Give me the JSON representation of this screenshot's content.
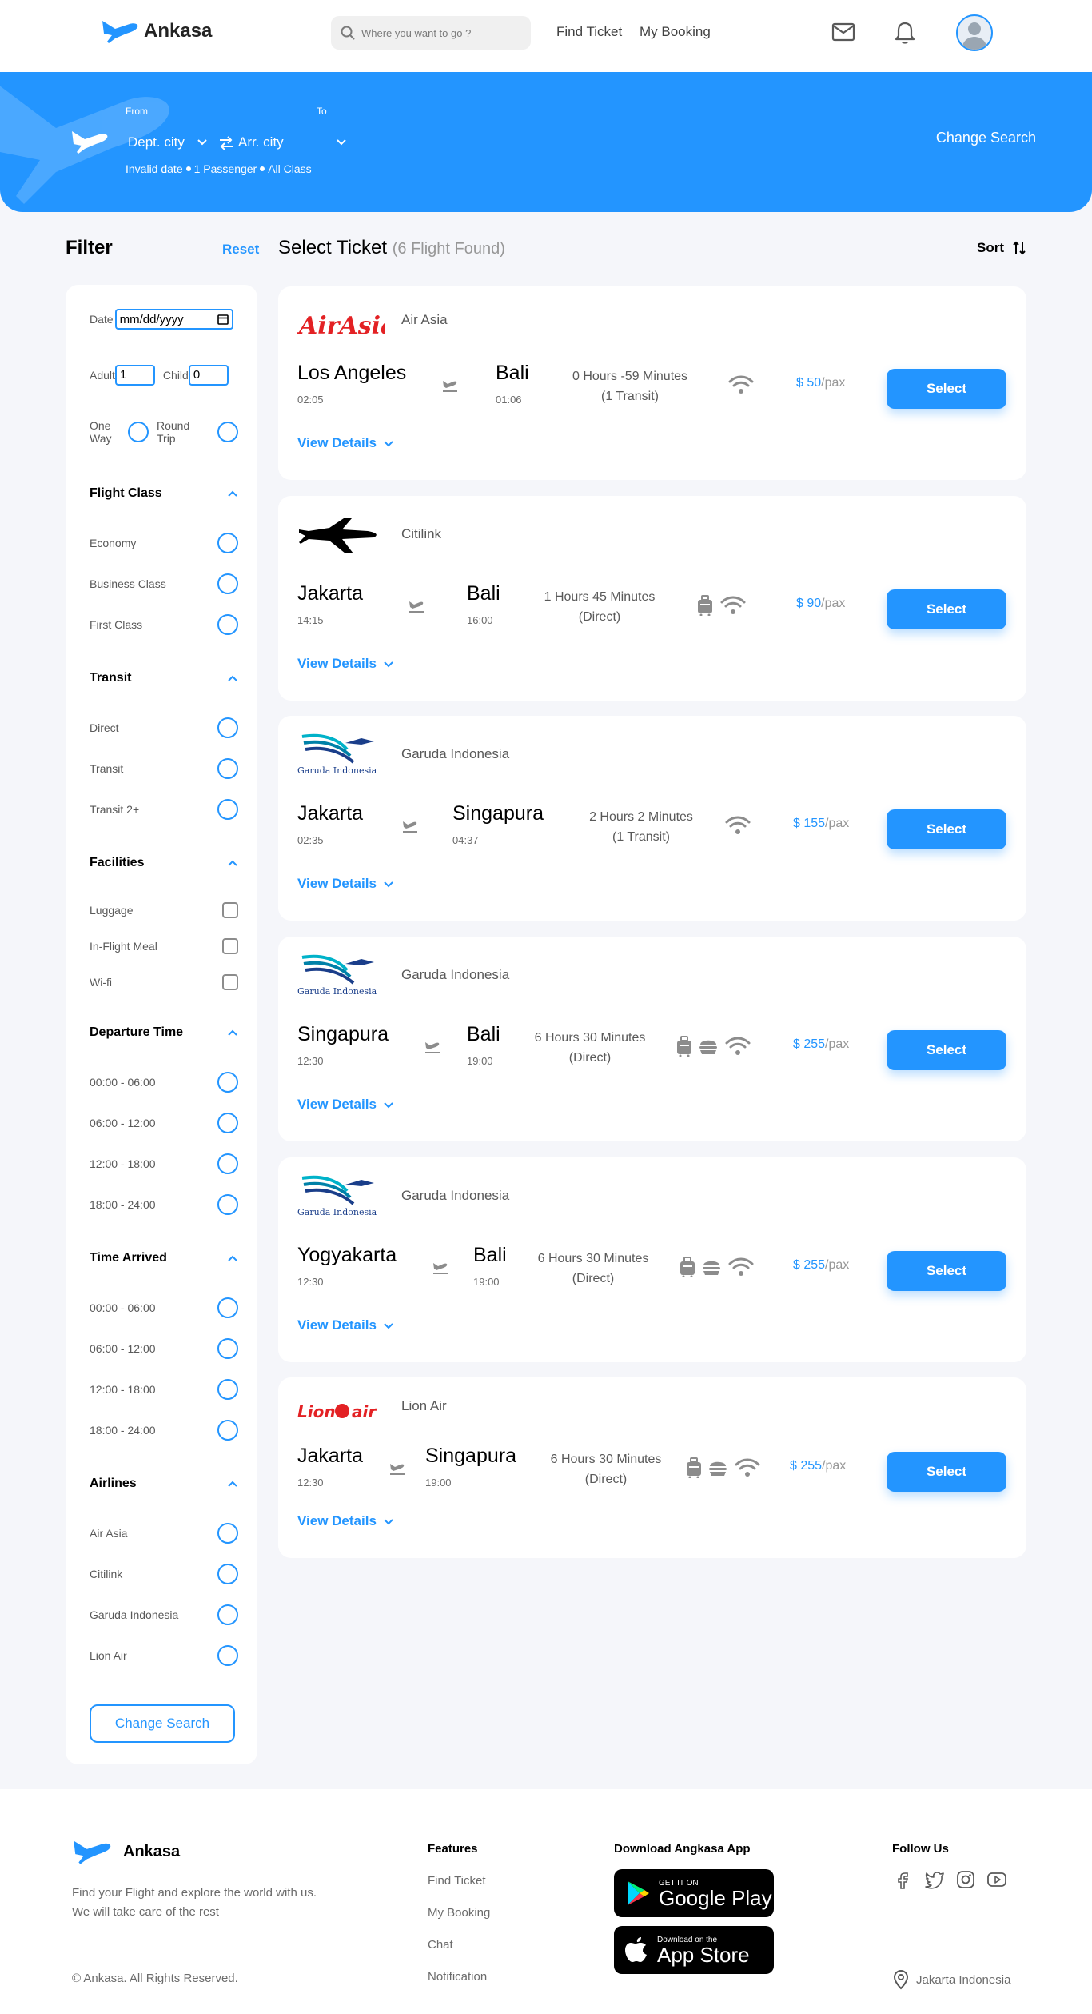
{
  "brand": {
    "name": "Ankasa",
    "accent": "#2395ff"
  },
  "navbar": {
    "search_placeholder": "Where you want to go ?",
    "links": [
      "Find Ticket",
      "My Booking"
    ],
    "icons": [
      "mail-icon",
      "bell-icon",
      "avatar"
    ]
  },
  "hero": {
    "from_label": "From",
    "to_label": "To",
    "from_city": "Dept. city",
    "to_city": "Arr. city",
    "info": [
      "Invalid date",
      "1 Passenger",
      "All Class"
    ],
    "change_search": "Change Search"
  },
  "filter": {
    "title": "Filter",
    "reset": "Reset",
    "date_label": "Date",
    "date_value": "mm/dd/yyyy",
    "adult_label": "Adult",
    "adult_value": "1",
    "child_label": "Child",
    "child_value": "0",
    "one_way": "One Way",
    "round_trip": "Round Trip",
    "sections": {
      "flight_class": {
        "title": "Flight Class",
        "options": [
          "Economy",
          "Business Class",
          "First Class"
        ]
      },
      "transit": {
        "title": "Transit",
        "options": [
          "Direct",
          "Transit",
          "Transit 2+"
        ]
      },
      "facilities": {
        "title": "Facilities",
        "options": [
          "Luggage",
          "In-Flight Meal",
          "Wi-fi"
        ]
      },
      "departure_time": {
        "title": "Departure Time",
        "options": [
          "00:00 - 06:00",
          "06:00 - 12:00",
          "12:00 - 18:00",
          "18:00 - 24:00"
        ]
      },
      "time_arrived": {
        "title": "Time Arrived",
        "options": [
          "00:00 - 06:00",
          "06:00 - 12:00",
          "12:00 - 18:00",
          "18:00 - 24:00"
        ]
      },
      "airlines": {
        "title": "Airlines",
        "options": [
          "Air Asia",
          "Citilink",
          "Garuda Indonesia",
          "Lion Air"
        ]
      }
    },
    "change_search": "Change Search"
  },
  "results": {
    "title": "Select Ticket",
    "found": "(6 Flight Found)",
    "sort": "Sort",
    "select_label": "Select",
    "details_label": "View Details",
    "pax": "/pax",
    "tickets": [
      {
        "airline": "Air Asia",
        "logo": "airasia-logo",
        "from": "Los Angeles",
        "dep": "02:05",
        "to": "Bali",
        "arr": "01:06",
        "duration": "0 Hours -59 Minutes",
        "transit": "(1 Transit)",
        "price": "$ 50",
        "facilities": [
          "wifi-icon"
        ]
      },
      {
        "airline": "Citilink",
        "logo": "citilink-logo",
        "from": "Jakarta",
        "dep": "14:15",
        "to": "Bali",
        "arr": "16:00",
        "duration": "1 Hours 45 Minutes",
        "transit": "(Direct)",
        "price": "$ 90",
        "facilities": [
          "luggage-icon",
          "wifi-icon"
        ]
      },
      {
        "airline": "Garuda Indonesia",
        "logo": "garuda-logo",
        "from": "Jakarta",
        "dep": "02:35",
        "to": "Singapura",
        "arr": "04:37",
        "duration": "2 Hours 2 Minutes",
        "transit": "(1 Transit)",
        "price": "$ 155",
        "facilities": [
          "wifi-icon"
        ]
      },
      {
        "airline": "Garuda Indonesia",
        "logo": "garuda-logo",
        "from": "Singapura",
        "dep": "12:30",
        "to": "Bali",
        "arr": "19:00",
        "duration": "6 Hours 30 Minutes",
        "transit": "(Direct)",
        "price": "$ 255",
        "facilities": [
          "luggage-icon",
          "meal-icon",
          "wifi-icon"
        ]
      },
      {
        "airline": "Garuda Indonesia",
        "logo": "garuda-logo",
        "from": "Yogyakarta",
        "dep": "12:30",
        "to": "Bali",
        "arr": "19:00",
        "duration": "6 Hours 30 Minutes",
        "transit": "(Direct)",
        "price": "$ 255",
        "facilities": [
          "luggage-icon",
          "meal-icon",
          "wifi-icon"
        ]
      },
      {
        "airline": "Lion Air",
        "logo": "lionair-logo",
        "from": "Jakarta",
        "dep": "12:30",
        "to": "Singapura",
        "arr": "19:00",
        "duration": "6 Hours 30 Minutes",
        "transit": "(Direct)",
        "price": "$ 255",
        "facilities": [
          "luggage-icon",
          "meal-icon",
          "wifi-icon"
        ]
      }
    ]
  },
  "footer": {
    "brand": "Ankasa",
    "description": "Find your Flight and explore the world with us. We will take care of the rest",
    "copyright": "© Ankasa. All Rights Reserved.",
    "features_title": "Features",
    "features": [
      "Find Ticket",
      "My Booking",
      "Chat",
      "Notification"
    ],
    "download_title": "Download Angkasa App",
    "google_small": "GET IT ON",
    "google_big": "Google Play",
    "apple_small": "Download on the",
    "apple_big": "App Store",
    "follow_title": "Follow Us",
    "socials": [
      "facebook-icon",
      "twitter-icon",
      "instagram-icon",
      "youtube-icon"
    ],
    "location": "Jakarta Indonesia"
  }
}
